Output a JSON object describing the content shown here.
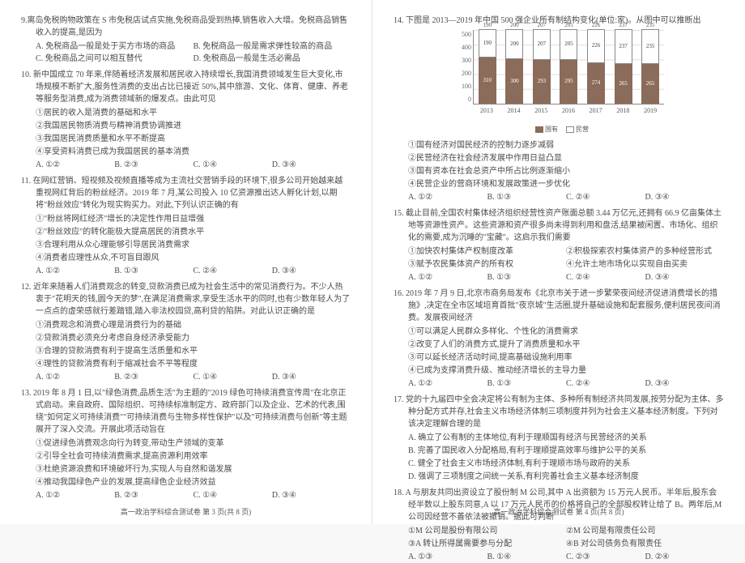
{
  "left": {
    "q9": {
      "text": "9.离岛免税购物政策在 S 市免税店试点实施,免税商品受到热捧,销售收入大增。免税商品销售收入的提高,是因为",
      "a": "A. 免税商品一般是处于买方市场的商品",
      "b": "B. 免税商品一般是需求弹性较高的商品",
      "c": "C. 免税商品之间可以相互替代",
      "d": "D. 免税商品一般是生活必需品"
    },
    "q10": {
      "text": "10. 新中国成立 70 年来,伴随着经济发展和居民收入持续增长,我国消费领域发生巨大变化,市场规模不断扩大,服务性消费的支出占比已接近 50%,其中旅游、文化、体育、健康、养老等服务型消费,成为消费领域新的爆发点。由此可见",
      "s1": "①居民的收入是消费的基础和水平",
      "s2": "②我国居民物质消费与精神消费协调推进",
      "s3": "③我国居民消费质量和水平不断提高",
      "s4": "④享受资料消费已成为我国居民的基本消费",
      "a": "A. ①②",
      "b": "B. ②③",
      "c": "C. ①④",
      "d": "D. ③④"
    },
    "q11": {
      "text": "11. 在网红营销、短视频及视频直播等成为主流社交营销手段的环境下,很多公司开始越来越重视网红背后的粉丝经济。2019 年 7 月,某公司投入 10 亿资源推出达人孵化计划,以期将\"粉丝效应\"转化为现实购买力。对此,下列认识正确的有",
      "s1": "①\"粉丝将网红经济\"增长的决定性作用日益增强",
      "s2": "②\"粉丝效应\"的转化能极大提高居民的消费水平",
      "s3": "③合理利用从众心理能够引导居民消费需求",
      "s4": "④消费者应理性从众,不可盲目跟风",
      "a": "A. ①②",
      "b": "B. ①③",
      "c": "C. ②④",
      "d": "D. ③④"
    },
    "q12": {
      "text": "12. 近年来随着人们消费观念的转变,贷款消费已成为社会生活中的常见消费行为。不少人热衷于\"花明天的钱,圆今天的梦\",在满足消费需求,享受生活水平的同时,也有少数年轻人为了一点点的虚荣感就行差踏错,踏入非法校园贷,高利贷的陷阱。对此认识正确的是",
      "s1": "①消费观念和消费心理是消费行为的基础",
      "s2": "②贷款消费必须充分考虑自身经济承受能力",
      "s3": "③合理的贷款消费有利于提高生活质量和水平",
      "s4": "④理性的贷款消费有利于缩减社会不平等程度",
      "a": "A. ①②",
      "b": "B. ②③",
      "c": "C. ①④",
      "d": "D. ③④"
    },
    "q13": {
      "text": "13. 2019 年 8 月 1 日,以\"绿色消费,品质生活\"为主题的\"2019 绿色可持续消费宣传周\"在北京正式启动。来自政府、国际组织、可持续标准制定方、政府部门以及企业、艺术的代表,围绕\"如何定义可持续消费\"\"可持续消费与生物多样性保护\"以及\"可持续消费与创新\"等主题展开了深入交流。开展此项活动旨在",
      "s1": "①促进绿色消费观念向行为转变,带动生产领域的变革",
      "s2": "②引导全社会可持续消费需求,提高资源利用效率",
      "s3": "③杜绝资源浪费和环境破坏行为,实现人与自然和谐发展",
      "s4": "④推动我国绿色产业的发展,提高绿色企业经济效益",
      "a": "A. ①②",
      "b": "B. ②③",
      "c": "C. ①④",
      "d": "D. ③④"
    },
    "footer": "高一政治学科综合测试卷 第 3 页(共 8 页)"
  },
  "right": {
    "q14": {
      "text": "14. 下图是 2013—2019 年中国 500 强企业所有制结构变化(单位:家)。从图中可以推断出",
      "s1": "①国有经济对国民经济的控制力逐步减弱",
      "s2": "②民营经济在社会经济发展中作用日益凸显",
      "s3": "③国有资本在社会总资产中所占比例逐渐缩小",
      "s4": "④民营企业的营商环境和发展政策进一步优化",
      "a": "A. ①②",
      "b": "B. ①③",
      "c": "C. ②④",
      "d": "D. ③④"
    },
    "q15": {
      "text": "15. 截止目前,全国农村集体经济组织经营性资产账面总额 3.44 万亿元,还拥有 66.9 亿亩集体土地等资源性资产。这些资源和资产很多尚未得到利用和盘活,结果被闲置、市场化、组织化的需要,成为沉睡的\"宝藏\"。这启示我们需要",
      "s1": "①加快农村集体产权制度改革",
      "s2": "②积极探索农村集体资产的多种经营形式",
      "s3": "③赋予农民集体资产的所有权",
      "s4": "④允许土地市场化以实现自由买卖",
      "a": "A. ①②",
      "b": "B. ①③",
      "c": "C. ②④",
      "d": "D. ③④"
    },
    "q16": {
      "text": "16. 2019 年 7 月 9 日,北京市商务局发布《北京市关于进一步繁荣夜间经济促进消费增长的措施》,决定在全市区域培育首批\"夜京城\"生活圈,提升基础设施和配套服务,便利居民夜间消费。发展夜间经济",
      "s1": "①可以满足人民群众多样化、个性化的消费需求",
      "s2": "②改变了人们的消费方式,提升了消费质量和水平",
      "s3": "③可以延长经济活动时间,提高基础设施利用率",
      "s4": "④已成为支撑消费升级、推动经济增长的主导力量",
      "a": "A. ①②",
      "b": "B. ①③",
      "c": "C. ②④",
      "d": "D. ③④"
    },
    "q17": {
      "text": "17. 党的十九届四中全会决定将公有制为主体、多种所有制经济共同发展,按劳分配为主体、多种分配方式并存,社会主义市场经济体制三项制度并列为社会主义基本经济制度。下列对该决定理解合理的是",
      "a": "A. 确立了公有制的主体地位,有利于理顺国有经济与民营经济的关系",
      "b": "B. 完善了国民收入分配格局,有利于理顺提高效率与维护公平的关系",
      "c": "C. 健全了社会主义市场经济体制,有利于理顺市场与政府的关系",
      "d": "D. 强调了三项制度之间统一关系,有利完善社会主义基本经济制度"
    },
    "q18": {
      "text": "18. A 与朋友共同出资设立了股份制 M 公司,其中 A 出资额为 15 万元人民币。半年后,股东会经半数以上股东同意,A 以 17 万元人民币的价格将自己的全部股权转让给了 B。两年后,M 公司因经营不善依法被撤销。据此可判断",
      "s1": "①M 公司是股份有限公司",
      "s2": "②M 公司是有限责任公司",
      "s3": "③A 转让所得属需要参与分配",
      "s4": "④B 对公司债务负有限责任",
      "a": "A. ①③",
      "b": "B. ①④",
      "c": "C. ②③",
      "d": "D. ②④"
    },
    "footer": "高一政治学科综合测试卷 第 4 页(共 8 页)"
  },
  "chart_data": {
    "type": "bar",
    "stacked": true,
    "title": "",
    "xlabel": "",
    "ylabel": "",
    "ylim": [
      0,
      500
    ],
    "yticks": [
      0,
      100,
      200,
      300,
      400,
      500
    ],
    "categories": [
      "2013",
      "2014",
      "2015",
      "2016",
      "2017",
      "2018",
      "2019"
    ],
    "series": [
      {
        "name": "国有",
        "values": [
          310,
          300,
          293,
          295,
          274,
          265,
          265
        ]
      },
      {
        "name": "民营",
        "values": [
          190,
          200,
          207,
          205,
          226,
          237,
          235
        ]
      }
    ],
    "legend": [
      "国有",
      "民营"
    ]
  }
}
